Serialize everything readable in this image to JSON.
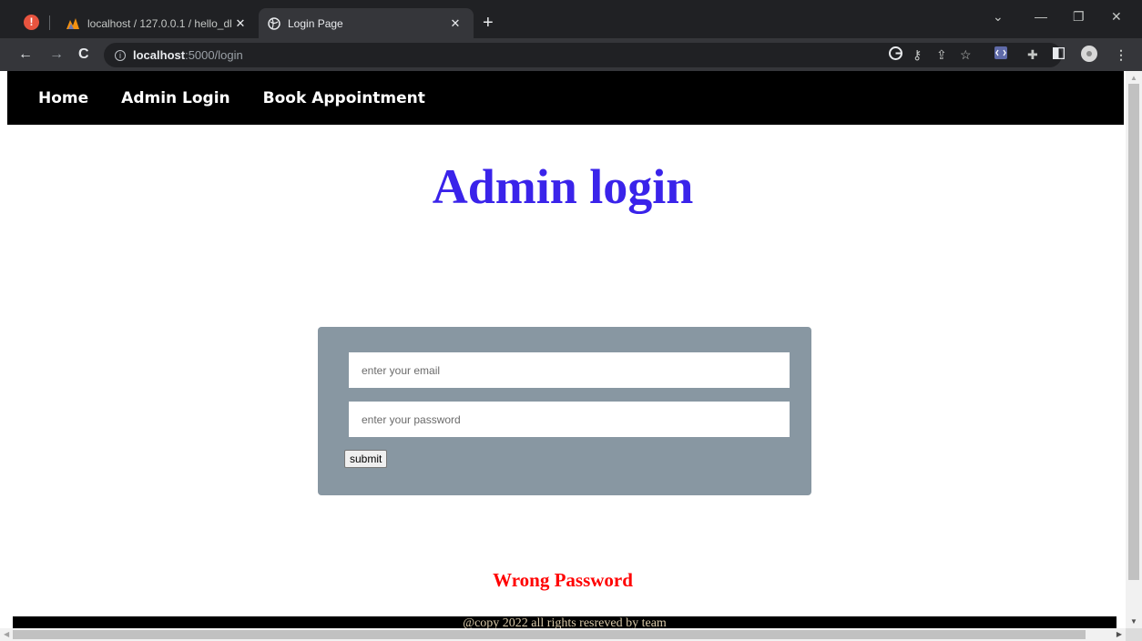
{
  "browser": {
    "tabs": [
      {
        "title": "localhost / 127.0.0.1 / hello_db /",
        "active": false
      },
      {
        "title": "Login Page",
        "active": true
      }
    ],
    "url_host": "localhost",
    "url_path": ":5000/login"
  },
  "site": {
    "nav": [
      "Home",
      "Admin Login",
      "Book Appointment"
    ],
    "title": "Admin login",
    "form": {
      "email_placeholder": "enter your email",
      "password_placeholder": "enter your password",
      "submit_label": "submit"
    },
    "error": "Wrong Password",
    "footer": "@copy 2022 all rights resreved by team"
  },
  "colors": {
    "title": "#3a23ea",
    "error": "#ff0000",
    "card": "#8897a2",
    "nav_bg": "#000000"
  }
}
